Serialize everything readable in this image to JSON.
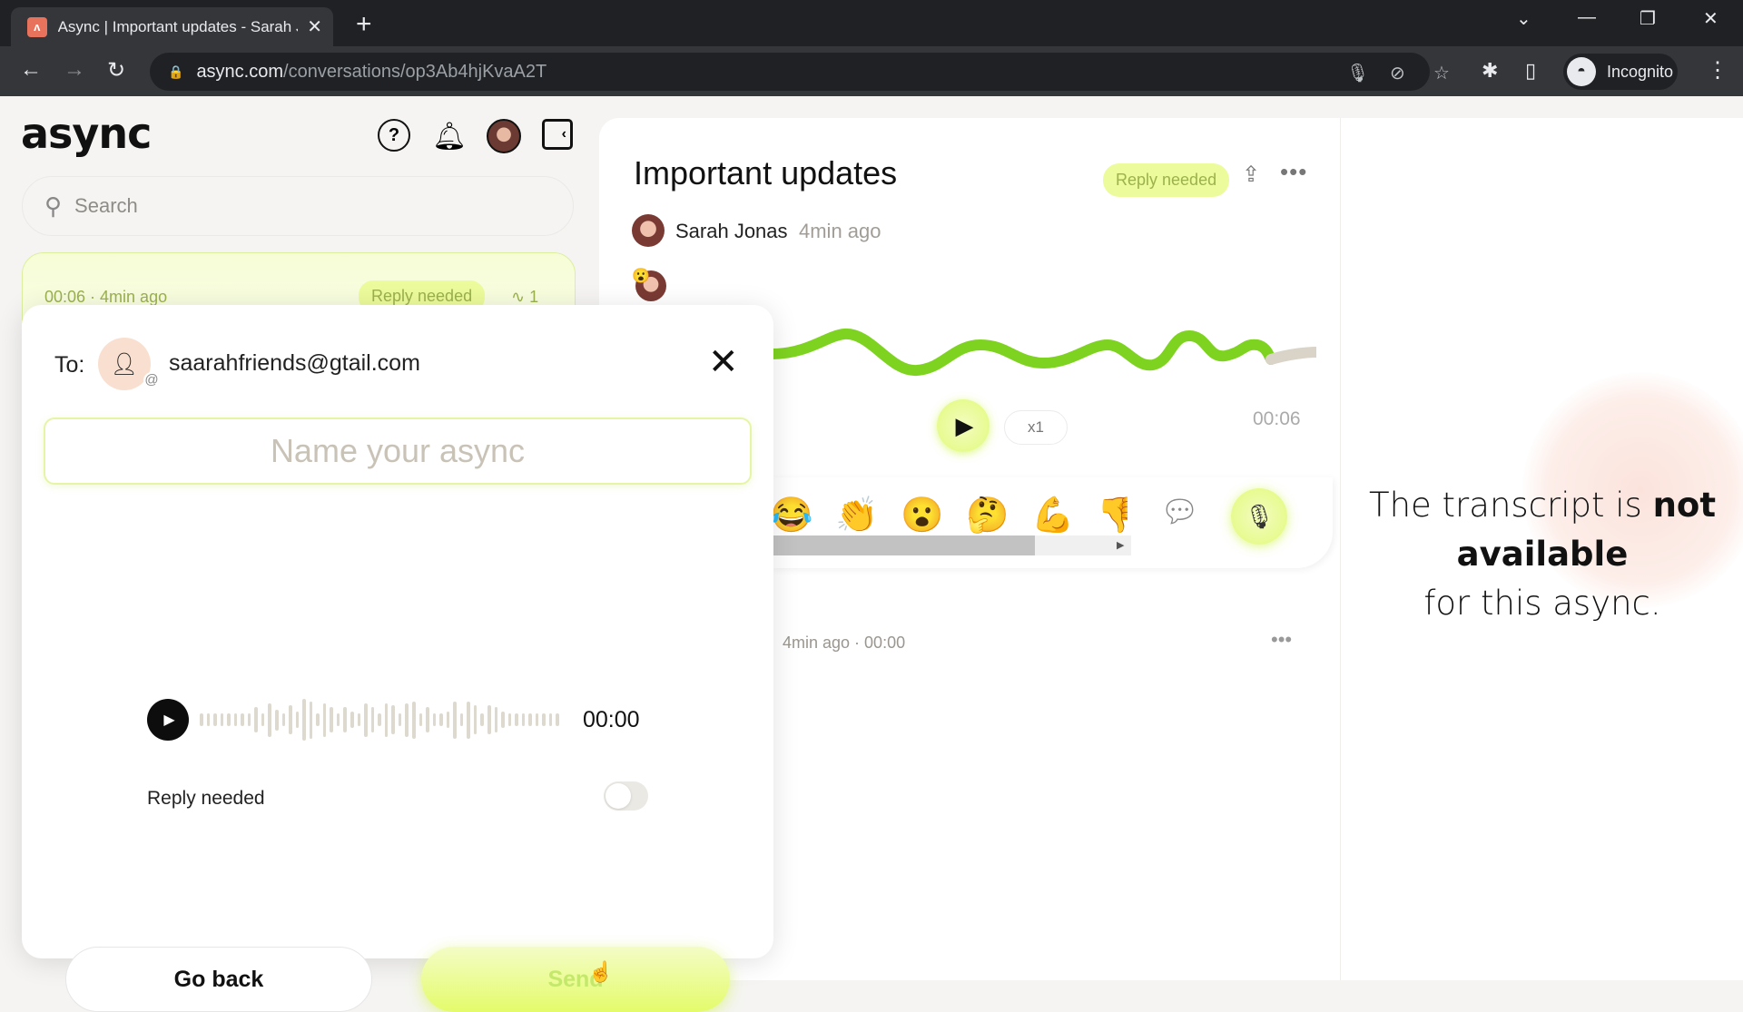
{
  "browser": {
    "tab_title": "Async | Important updates - Sarah Jonas",
    "url_host": "async.com",
    "url_path": "/conversations/op3Ab4hjKvaA2T",
    "profile_label": "Incognito"
  },
  "header": {
    "logo": "async",
    "help_icon": "?",
    "collapse_icon": "‹"
  },
  "search": {
    "placeholder": "Search"
  },
  "conversation_card": {
    "meta": "00:06 · 4min ago",
    "badge": "Reply needed",
    "count": "1"
  },
  "modal": {
    "to_label": "To:",
    "recipient_email": "saarahfriends@gtail.com",
    "name_placeholder": "Name your async",
    "name_value": "",
    "recording_time": "00:00",
    "reply_needed_label": "Reply needed",
    "reply_needed": false,
    "back_label": "Go back",
    "send_label": "Send",
    "waveform_levels": [
      0.3,
      0.3,
      0.3,
      0.3,
      0.3,
      0.3,
      0.3,
      0.3,
      0.6,
      0.3,
      0.8,
      0.5,
      0.3,
      0.7,
      0.4,
      1.0,
      0.9,
      0.3,
      0.8,
      0.6,
      0.3,
      0.6,
      0.4,
      0.3,
      0.8,
      0.6,
      0.3,
      0.8,
      0.7,
      0.3,
      0.8,
      0.9,
      0.3,
      0.6,
      0.3,
      0.3,
      0.4,
      0.9,
      0.3,
      0.9,
      0.7,
      0.3,
      0.7,
      0.6,
      0.4,
      0.3,
      0.3,
      0.3,
      0.3,
      0.3,
      0.3,
      0.3,
      0.3
    ]
  },
  "conversation": {
    "title": "Important updates",
    "badge": "Reply needed",
    "author": "Sarah Jonas",
    "time": "4min ago",
    "reaction": "😮",
    "playback_speed": "x1",
    "duration": "00:06",
    "played_fraction": 0.85,
    "reactions": [
      "😂",
      "👏",
      "😮",
      "🤔",
      "💪",
      "👎"
    ],
    "reply_meta": "4min ago · 00:00"
  },
  "transcript": {
    "line1_pre": "The transcript is ",
    "line1_bold": "not",
    "line2_bold": "available",
    "line3": "for this async."
  },
  "colors": {
    "accent": "#e0fa7a",
    "accent_text": "#9bb24d",
    "wave": "#7ed321"
  }
}
